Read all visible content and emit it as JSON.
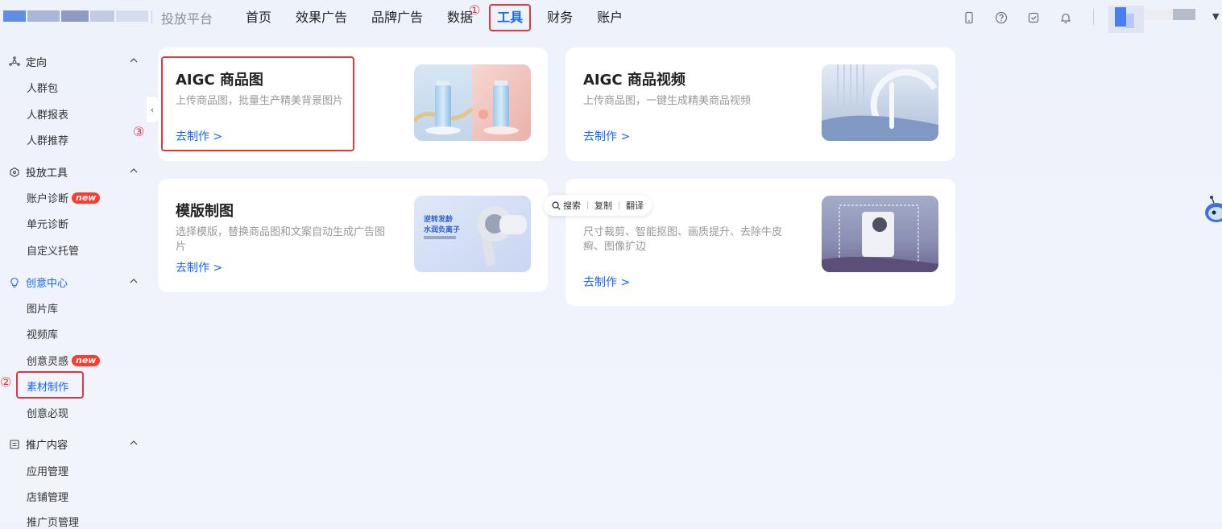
{
  "header": {
    "brand": "投放平台",
    "nav": [
      {
        "label": "首页"
      },
      {
        "label": "效果广告"
      },
      {
        "label": "品牌广告"
      },
      {
        "label": "数据"
      },
      {
        "label": "工具"
      },
      {
        "label": "财务"
      },
      {
        "label": "账户"
      }
    ],
    "active_nav": "工具"
  },
  "annotations": {
    "one": "①",
    "two": "②",
    "three": "③"
  },
  "sidebar": {
    "collapse_glyph": "‹",
    "groups": [
      {
        "label": "定向",
        "items": [
          "人群包",
          "人群报表",
          "人群推荐"
        ]
      },
      {
        "label": "投放工具",
        "items": [
          "账户诊断",
          "单元诊断",
          "自定义托管"
        ]
      },
      {
        "label": "创意中心",
        "items": [
          "图片库",
          "视频库",
          "创意灵感",
          "素材制作",
          "创意必现"
        ]
      },
      {
        "label": "推广内容",
        "items": [
          "应用管理",
          "店铺管理",
          "推广页管理"
        ]
      }
    ],
    "badge_new": "new",
    "active_item": "素材制作"
  },
  "cards": [
    {
      "title": "AIGC 商品图",
      "desc": "上传商品图，批量生产精美背景图片",
      "link": "去制作 >"
    },
    {
      "title": "AIGC 商品视频",
      "desc": "上传商品图，一键生成精美商品视频",
      "link": "去制作 >"
    },
    {
      "title": "模版制图",
      "desc": "选择模版，替换商品图和文案自动生成广告图片",
      "link": "去制作 >",
      "thumb_text": [
        "逆转发龄",
        "水润负离子"
      ]
    },
    {
      "title": "",
      "desc": "尺寸裁剪、智能抠图、画质提升、去除牛皮癣、图像扩边",
      "link": "去制作 >"
    }
  ],
  "floating_toolbar": {
    "search": "搜索",
    "copy": "复制",
    "translate": "翻译"
  },
  "colors": {
    "accent": "#1766ff",
    "annotation_red": "#e0383e",
    "badge_red": "#ff3b30"
  }
}
